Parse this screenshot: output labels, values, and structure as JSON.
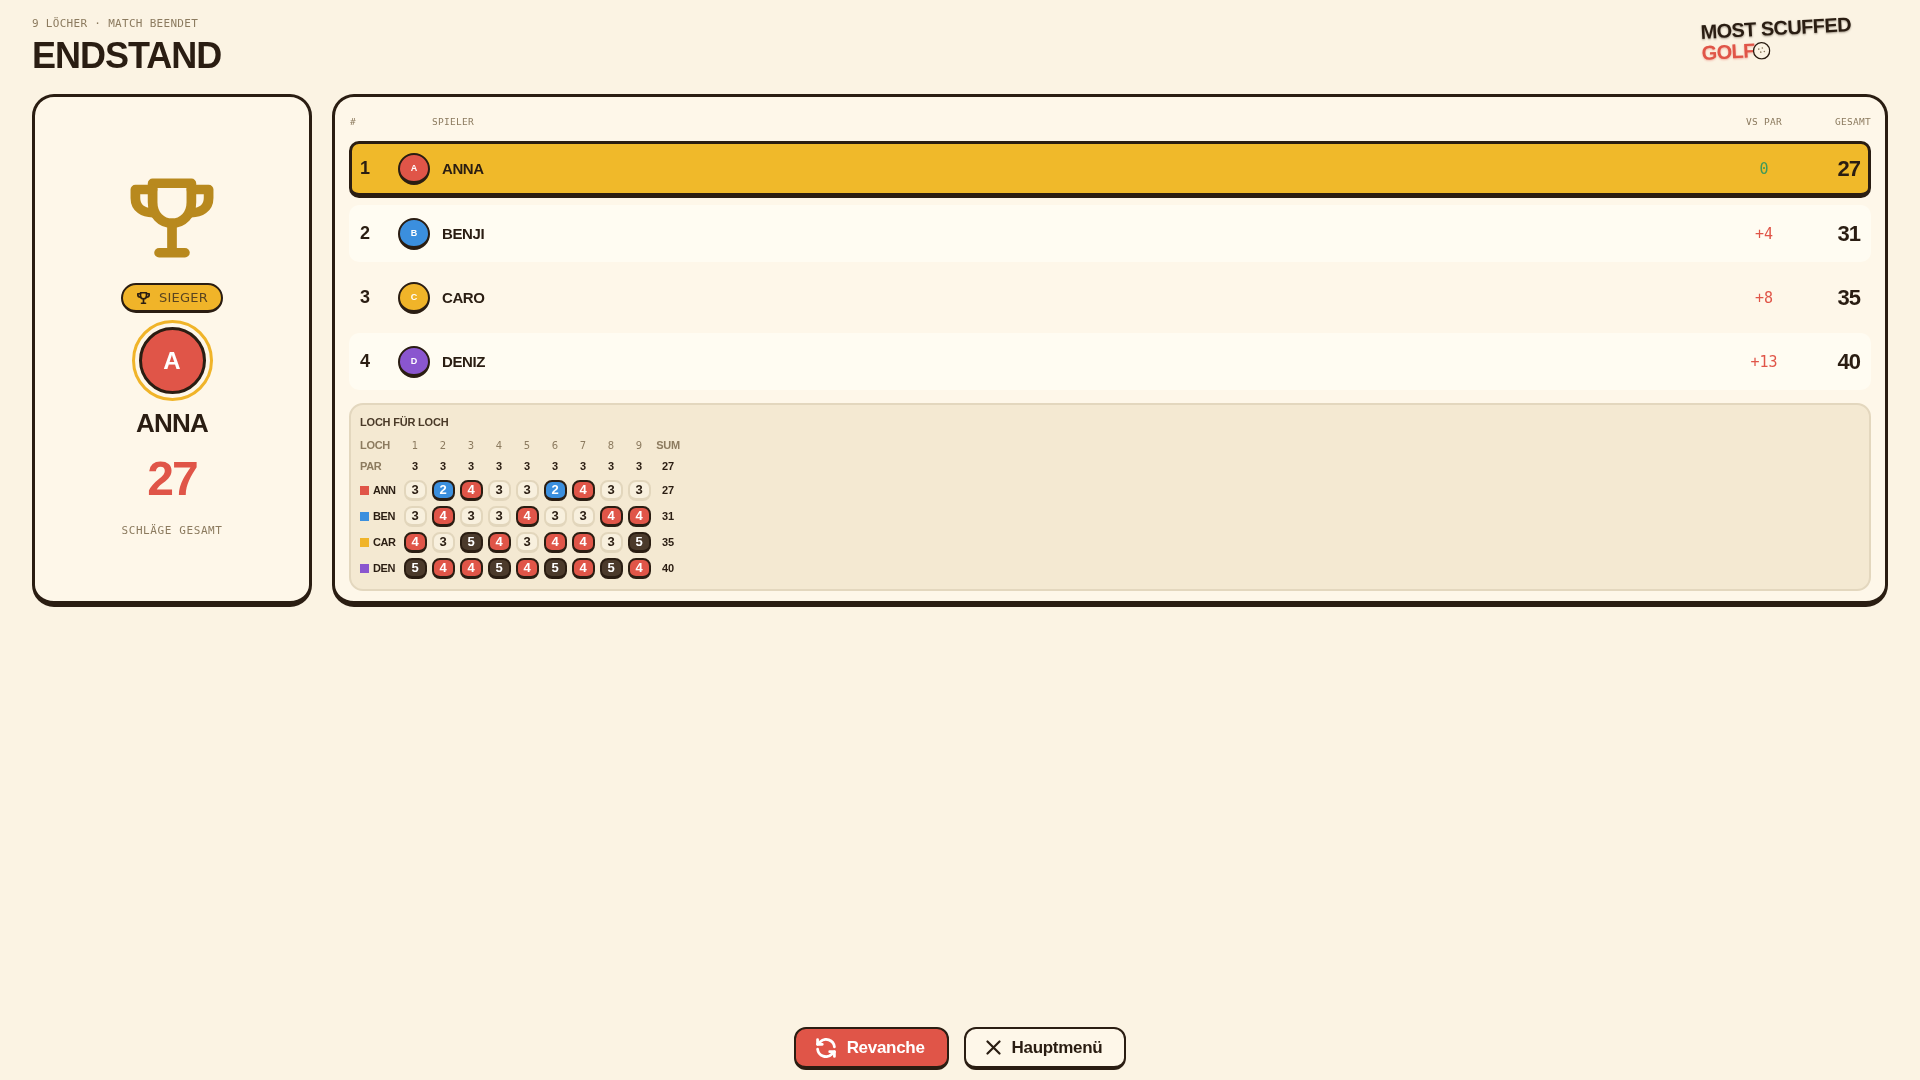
{
  "header": {
    "subtitle": "9 LÖCHER · MATCH BEENDET",
    "title": "ENDSTAND"
  },
  "logo": {
    "line_1": "MOST SCUFFED",
    "line_2": "GOLF"
  },
  "winner": {
    "badge": "SIEGER",
    "initial": "A",
    "color": "#e05548",
    "name": "ANNA",
    "score": "27",
    "caption": "SCHLÄGE GESAMT"
  },
  "standings": {
    "columns": [
      "#",
      "SPIELER",
      "VS PAR",
      "GESAMT"
    ],
    "rows": [
      {
        "rank": "1",
        "initial": "A",
        "color": "#e05548",
        "name": "ANNA",
        "vs_par": {
          "value": "0",
          "kind": "even"
        },
        "total": "27",
        "highlighted": true
      },
      {
        "rank": "2",
        "initial": "B",
        "color": "#3b8fde",
        "name": "BENJI",
        "vs_par": {
          "value": "+4",
          "kind": "over"
        },
        "total": "31",
        "highlighted": false
      },
      {
        "rank": "3",
        "initial": "C",
        "color": "#f0b429",
        "name": "CARO",
        "vs_par": {
          "value": "+8",
          "kind": "over"
        },
        "total": "35",
        "highlighted": false
      },
      {
        "rank": "4",
        "initial": "D",
        "color": "#8a56cf",
        "name": "DENIZ",
        "vs_par": {
          "value": "+13",
          "kind": "over"
        },
        "total": "40",
        "highlighted": false
      }
    ]
  },
  "hole_by_hole": {
    "title": "LOCH FÜR LOCH",
    "header": {
      "label": "LOCH",
      "holes": [
        "1",
        "2",
        "3",
        "4",
        "5",
        "6",
        "7",
        "8",
        "9"
      ],
      "sum": "SUM"
    },
    "par": {
      "label": "PAR",
      "values": [
        "3",
        "3",
        "3",
        "3",
        "3",
        "3",
        "3",
        "3",
        "3"
      ],
      "sum": "27"
    },
    "rows": [
      {
        "label": "ANN",
        "color": "#e05548",
        "scores": [
          {
            "score": "3",
            "kind": "par"
          },
          {
            "score": "2",
            "kind": "birdie"
          },
          {
            "score": "4",
            "kind": "bogey"
          },
          {
            "score": "3",
            "kind": "par"
          },
          {
            "score": "3",
            "kind": "par"
          },
          {
            "score": "2",
            "kind": "birdie"
          },
          {
            "score": "4",
            "kind": "bogey"
          },
          {
            "score": "3",
            "kind": "par"
          },
          {
            "score": "3",
            "kind": "par"
          }
        ],
        "sum": "27"
      },
      {
        "label": "BEN",
        "color": "#3b8fde",
        "scores": [
          {
            "score": "3",
            "kind": "par"
          },
          {
            "score": "4",
            "kind": "bogey"
          },
          {
            "score": "3",
            "kind": "par"
          },
          {
            "score": "3",
            "kind": "par"
          },
          {
            "score": "4",
            "kind": "bogey"
          },
          {
            "score": "3",
            "kind": "par"
          },
          {
            "score": "3",
            "kind": "par"
          },
          {
            "score": "4",
            "kind": "bogey"
          },
          {
            "score": "4",
            "kind": "bogey"
          }
        ],
        "sum": "31"
      },
      {
        "label": "CAR",
        "color": "#f0b429",
        "scores": [
          {
            "score": "4",
            "kind": "bogey"
          },
          {
            "score": "3",
            "kind": "par"
          },
          {
            "score": "5",
            "kind": "double"
          },
          {
            "score": "4",
            "kind": "bogey"
          },
          {
            "score": "3",
            "kind": "par"
          },
          {
            "score": "4",
            "kind": "bogey"
          },
          {
            "score": "4",
            "kind": "bogey"
          },
          {
            "score": "3",
            "kind": "par"
          },
          {
            "score": "5",
            "kind": "double"
          }
        ],
        "sum": "35"
      },
      {
        "label": "DEN",
        "color": "#8a56cf",
        "scores": [
          {
            "score": "5",
            "kind": "double"
          },
          {
            "score": "4",
            "kind": "bogey"
          },
          {
            "score": "4",
            "kind": "bogey"
          },
          {
            "score": "5",
            "kind": "double"
          },
          {
            "score": "4",
            "kind": "bogey"
          },
          {
            "score": "5",
            "kind": "double"
          },
          {
            "score": "4",
            "kind": "bogey"
          },
          {
            "score": "5",
            "kind": "double"
          },
          {
            "score": "4",
            "kind": "bogey"
          }
        ],
        "sum": "40"
      }
    ]
  },
  "buttons": [
    {
      "label": "Revanche",
      "kind": "primary"
    },
    {
      "label": "Hauptmenü",
      "kind": "secondary"
    }
  ]
}
